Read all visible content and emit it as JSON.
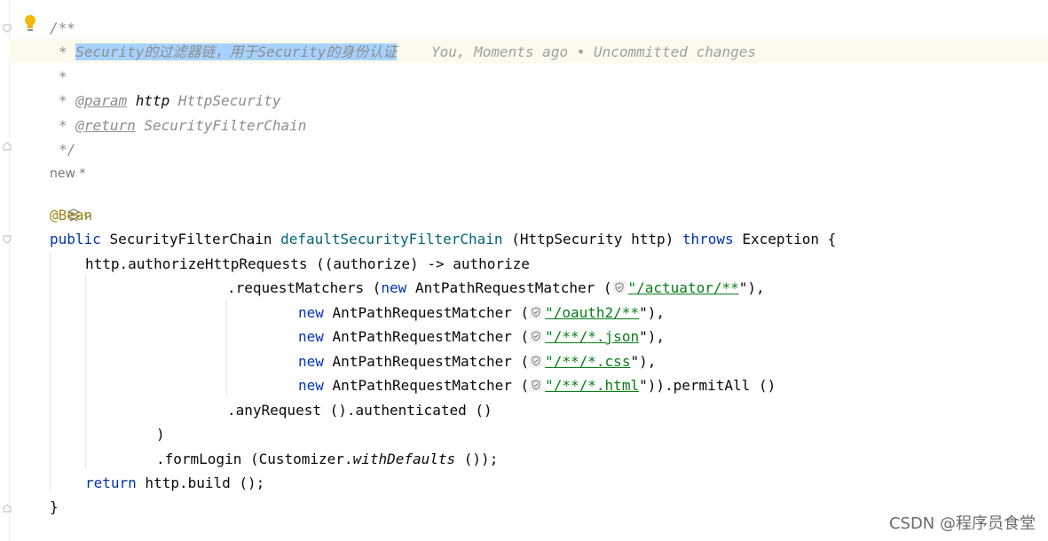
{
  "doc": {
    "open": "/**",
    "star": "*",
    "comment": "Security的过滤器链，用于Security的身份认证",
    "blame": "You, Moments ago • Uncommitted changes",
    "param_tag": "@param",
    "param_name": "http",
    "param_type": "HttpSecurity",
    "return_tag": "@return",
    "return_type": "SecurityFilterChain",
    "close": "*/"
  },
  "inlay": {
    "usages": "new *",
    "generate_icon": "ai-generate-icon"
  },
  "code": {
    "annotation": "@Bean",
    "kw_public": "public",
    "return_type": "SecurityFilterChain",
    "method": "defaultSecurityFilterChain",
    "params": "(HttpSecurity http)",
    "kw_throws": "throws",
    "exception": "Exception {",
    "l2": "http.authorizeHttpRequests ((authorize) -> authorize",
    "l3_a": ".requestMatchers (",
    "kw_new": "new",
    "matcher": "AntPathRequestMatcher (",
    "path1": "/actuator/**",
    "path2": "/oauth2/**",
    "path3": "/**/*.json",
    "path4": "/**/*.css",
    "path5": "/**/*.html",
    "tail1": "\"),",
    "tail5": "\")).permitAll ()",
    "l8": ".anyRequest ().authenticated ()",
    "l9": ")",
    "l10_a": ".formLogin (Customizer.",
    "l10_b": "withDefaults",
    "l10_c": " ());",
    "kw_return": "return",
    "l11": " http.build ();",
    "l12": "}"
  },
  "watermark": "CSDN @程序员食堂",
  "colors": {
    "keyword": "#0033b3",
    "annotation": "#9e880d",
    "method": "#00627a",
    "string": "#067d17",
    "comment": "#8c8c8c",
    "selection": "#a6d2ff"
  }
}
